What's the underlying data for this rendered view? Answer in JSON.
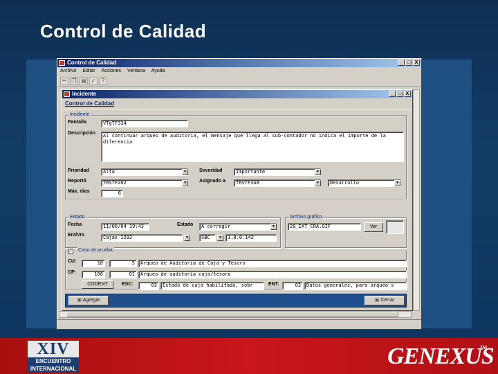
{
  "slide": {
    "title": "Control de Calidad"
  },
  "app": {
    "title": "Control de Calidad",
    "menu": [
      "Archivo",
      "Editar",
      "Acciones",
      "Ventana",
      "Ayuda"
    ],
    "window_buttons": [
      "_",
      "□",
      "X"
    ]
  },
  "child": {
    "title": "Incidente",
    "header_link": "Control de Calidad",
    "window_buttons": [
      "_",
      "□",
      "X"
    ],
    "incidente": {
      "group_label": "Incidente",
      "pantalla_label": "Pantalla",
      "pantalla_value": "VTgTF334",
      "descripcion_label": "Descripción",
      "descripcion_value": "Al continuar arqueo de auditoria, el mensaje que llega al sub-contador no indica el importe de la diferencia",
      "prioridad_label": "Prioridad",
      "prioridad_value": "Alta",
      "severidad_label": "Severidad",
      "severidad_value": "Importante",
      "reporto_label": "Reportó",
      "reporto_value": "TRSTF202",
      "asignado_label": "Asignado a",
      "asignado_value": "TRSTF340",
      "asignado_extra": "Desarrollo",
      "max_dias_label": "Máx. días",
      "max_dias_value": "6"
    },
    "estado": {
      "group_label": "Estado",
      "fecha_label": "Fecha",
      "fecha_value": "11/06/04 19:43",
      "estado_label": "Estado",
      "estado_value": "A corregir",
      "ent_vrs_label": "Ent/Vrs",
      "ent_value": "Cajas 1292",
      "vrs_code": "SBC",
      "vrs_value": "1.0.0.142",
      "archivo_label": "Archivo gráfico",
      "archivo_value": "20_IAT_CRA.GIF",
      "ver_button": "Ver"
    },
    "caso": {
      "group_label": "Caso de prueba",
      "checked": "✓",
      "cu_label": "CU:",
      "cu_num": "10",
      "cu_id": "5",
      "cu_desc": "Arqueo de Auditoria de Caja y Tesoro",
      "cp_label": "CP:",
      "cp_num": "106",
      "cp_id": "01",
      "cp_desc": "Arqueo de auditoria caja/tesoro",
      "cod_label": "CODENT",
      "esc_label": "ESC:",
      "esc_num": "03",
      "esc_desc": "Estado de caja habilitada, sobr",
      "ent_label": "ENT:",
      "ent_num": "03",
      "ent_desc": "Datos generales, para arqueo s"
    },
    "agregar_button": "Agregar",
    "cerrar_button": "Cerrar"
  },
  "footer": {
    "logo_left_big": "XIV",
    "logo_left_line1": "ENCUENTRO",
    "logo_left_line2": "INTERNACIONAL",
    "logo_right": "GENEXUS",
    "logo_right_tm": "TM"
  }
}
